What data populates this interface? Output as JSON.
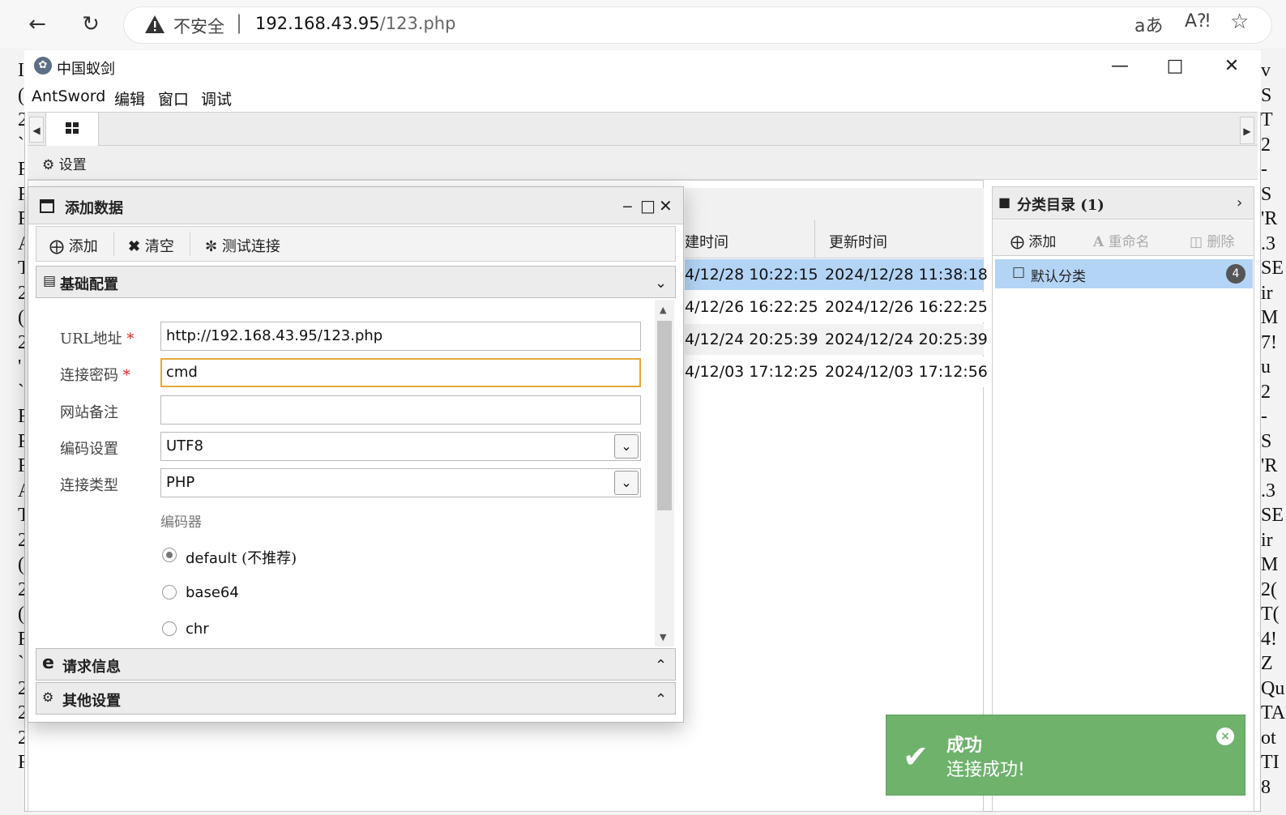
{
  "browser": {
    "insecure_label": "不安全",
    "separator": "|",
    "url_host": "192.168.43.95",
    "url_path": "/123.php"
  },
  "app": {
    "title": "中国蚁剑",
    "menu": [
      "AntSword",
      "编辑",
      "窗口",
      "调试"
    ],
    "toolbar_settings": "设置"
  },
  "grid": {
    "columns": [
      "建时间",
      "更新时间"
    ],
    "rows": [
      {
        "created": "4/12/28 10:22:15",
        "updated": "2024/12/28 11:38:18"
      },
      {
        "created": "4/12/26 16:22:25",
        "updated": "2024/12/26 16:22:25"
      },
      {
        "created": "4/12/24 20:25:39",
        "updated": "2024/12/24 20:25:39"
      },
      {
        "created": "4/12/03 17:12:25",
        "updated": "2024/12/03 17:12:56"
      }
    ]
  },
  "category": {
    "title": "分类目录 (1)",
    "add": "添加",
    "rename": "重命名",
    "delete": "删除",
    "item_label": "默认分类",
    "item_count": "4"
  },
  "dialog": {
    "title": "添加数据",
    "toolbar": {
      "add": "添加",
      "clear": "清空",
      "test": "测试连接"
    },
    "section_basic": "基础配置",
    "section_request": "请求信息",
    "section_other": "其他设置",
    "fields": {
      "url_label": "URL地址",
      "url_value": "http://192.168.43.95/123.php",
      "password_label": "连接密码",
      "password_value": "cmd",
      "note_label": "网站备注",
      "note_value": "",
      "encoding_label": "编码设置",
      "encoding_value": "UTF8",
      "type_label": "连接类型",
      "type_value": "PHP"
    },
    "encoder_title": "编码器",
    "encoders": [
      {
        "label": "default",
        "note": "(不推荐)",
        "selected": true
      },
      {
        "label": "base64",
        "note": "",
        "selected": false
      },
      {
        "label": "chr",
        "note": "",
        "selected": false
      }
    ]
  },
  "toast": {
    "title": "成功",
    "message": "连接成功!",
    "color": "#6eb26c"
  },
  "background_page": {
    "left_chars": [
      "I",
      "(",
      "2",
      "`",
      "F",
      "F",
      "F",
      "A",
      "T",
      "2",
      "(",
      "2",
      "'",
      "`",
      "F",
      "F",
      "F",
      "A",
      "T",
      "2",
      "(",
      "2",
      "(",
      "F",
      "`",
      "2",
      "2",
      "2",
      "F"
    ],
    "right_chars": [
      "v",
      "S",
      "T",
      "2",
      "-",
      "S",
      "'R",
      ".3",
      "SE",
      "ir",
      "M",
      "7!",
      "u",
      "2",
      "-",
      "S",
      "'R",
      ".3",
      "SE",
      "ir",
      "M",
      "2(",
      "T(",
      "4!",
      "Z",
      "Qu",
      "TA",
      "ot",
      "TI",
      "8"
    ]
  }
}
